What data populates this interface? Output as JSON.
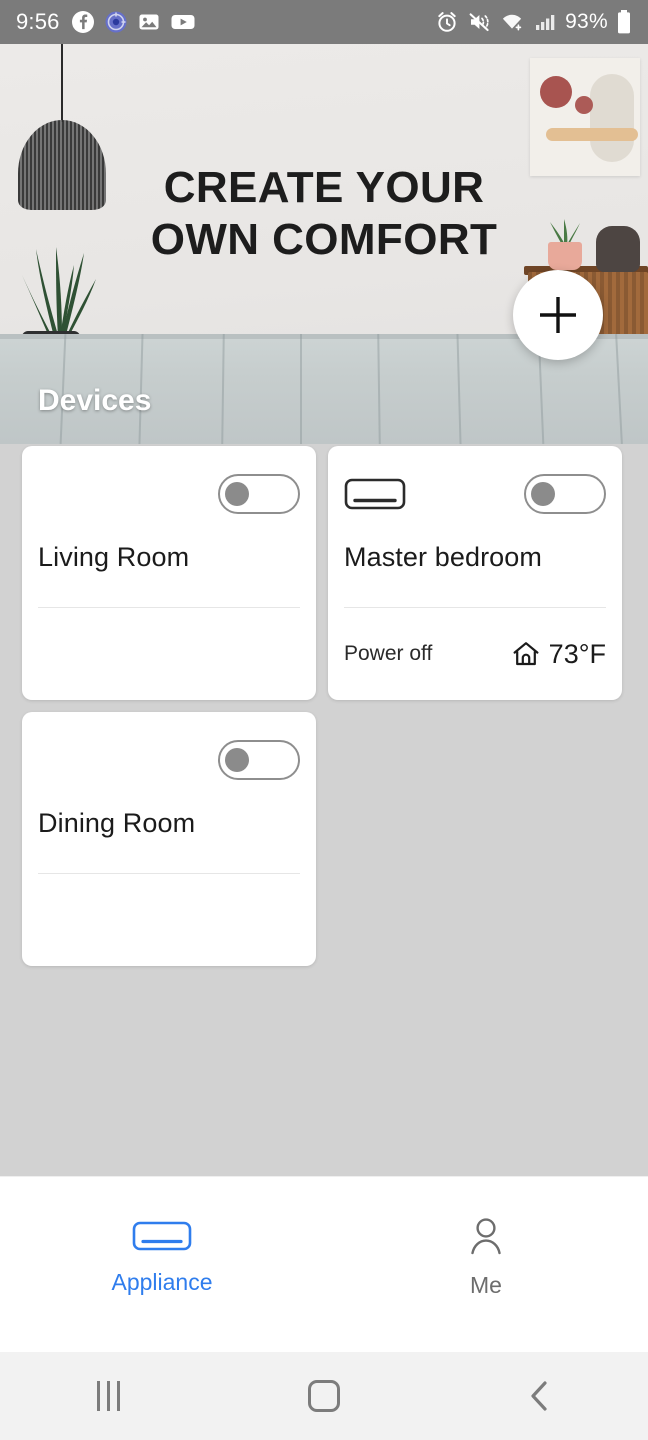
{
  "status_bar": {
    "time": "9:56",
    "battery_percent": "93%",
    "left_icons": [
      "facebook-icon",
      "circle-sync-icon",
      "photos-icon",
      "youtube-icon"
    ],
    "right_icons": [
      "alarm-icon",
      "mute-vibrate-icon",
      "wifi-icon",
      "signal-icon",
      "battery-icon"
    ],
    "background_color": "#7b7b7b"
  },
  "hero": {
    "title_line1": "CREATE YOUR",
    "title_line2": "OWN COMFORT",
    "add_button_label": "+",
    "section_label": "Devices"
  },
  "devices": [
    {
      "name": "Living Room",
      "toggle_state": "off",
      "has_ac_icon": false,
      "status": "",
      "temperature": "",
      "show_footer_info": false
    },
    {
      "name": "Master bedroom",
      "toggle_state": "off",
      "has_ac_icon": true,
      "status": "Power off",
      "temperature": "73°F",
      "show_footer_info": true
    },
    {
      "name": "Dining Room",
      "toggle_state": "off",
      "has_ac_icon": false,
      "status": "",
      "temperature": "",
      "show_footer_info": false
    }
  ],
  "bottom_nav": {
    "items": [
      {
        "label": "Appliance",
        "icon": "air-conditioner-icon",
        "active": true
      },
      {
        "label": "Me",
        "icon": "person-icon",
        "active": false
      }
    ],
    "active_color": "#2f7ded",
    "inactive_color": "#6d6d6d"
  },
  "system_nav": {
    "recents_label": "recents",
    "home_label": "home",
    "back_label": "back"
  }
}
